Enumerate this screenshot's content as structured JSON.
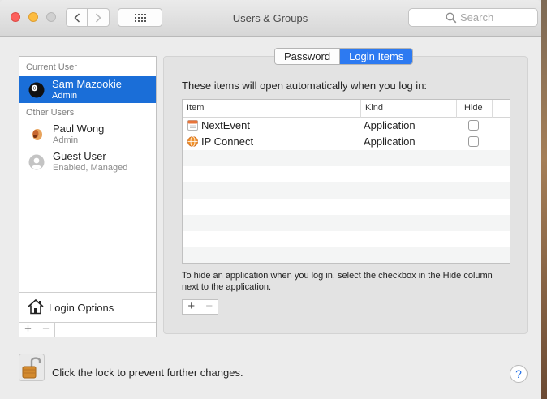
{
  "window": {
    "title": "Users & Groups",
    "search_placeholder": "Search"
  },
  "sidebar": {
    "current_user_header": "Current User",
    "other_users_header": "Other Users",
    "current_user": {
      "name": "Sam Mazookie",
      "role": "Admin",
      "icon": "billiard-ball-icon"
    },
    "other_users": [
      {
        "name": "Paul Wong",
        "role": "Admin",
        "icon": "flower-icon"
      },
      {
        "name": "Guest User",
        "role": "Enabled, Managed",
        "icon": "guest-avatar-icon"
      }
    ],
    "login_options": "Login Options",
    "add_label": "+",
    "remove_label": "−"
  },
  "tabs": [
    {
      "label": "Password",
      "active": false
    },
    {
      "label": "Login Items",
      "active": true
    }
  ],
  "login_items": {
    "intro": "These items will open automatically when you log in:",
    "columns": [
      "Item",
      "Kind",
      "Hide"
    ],
    "rows": [
      {
        "item": "NextEvent",
        "kind": "Application",
        "hide": false,
        "icon": "calendar-icon"
      },
      {
        "item": "IP Connect",
        "kind": "Application",
        "hide": false,
        "icon": "globe-icon"
      }
    ],
    "hint": "To hide an application when you log in, select the checkbox in the Hide column next to the application.",
    "add_label": "+",
    "remove_label": "−"
  },
  "footer": {
    "lock_text": "Click the lock to prevent further changes.",
    "help_label": "?"
  },
  "colors": {
    "selection": "#1a6ed8",
    "tab_active": "#2d7af1",
    "close": "#fc605c",
    "minimize": "#fdbc40"
  }
}
